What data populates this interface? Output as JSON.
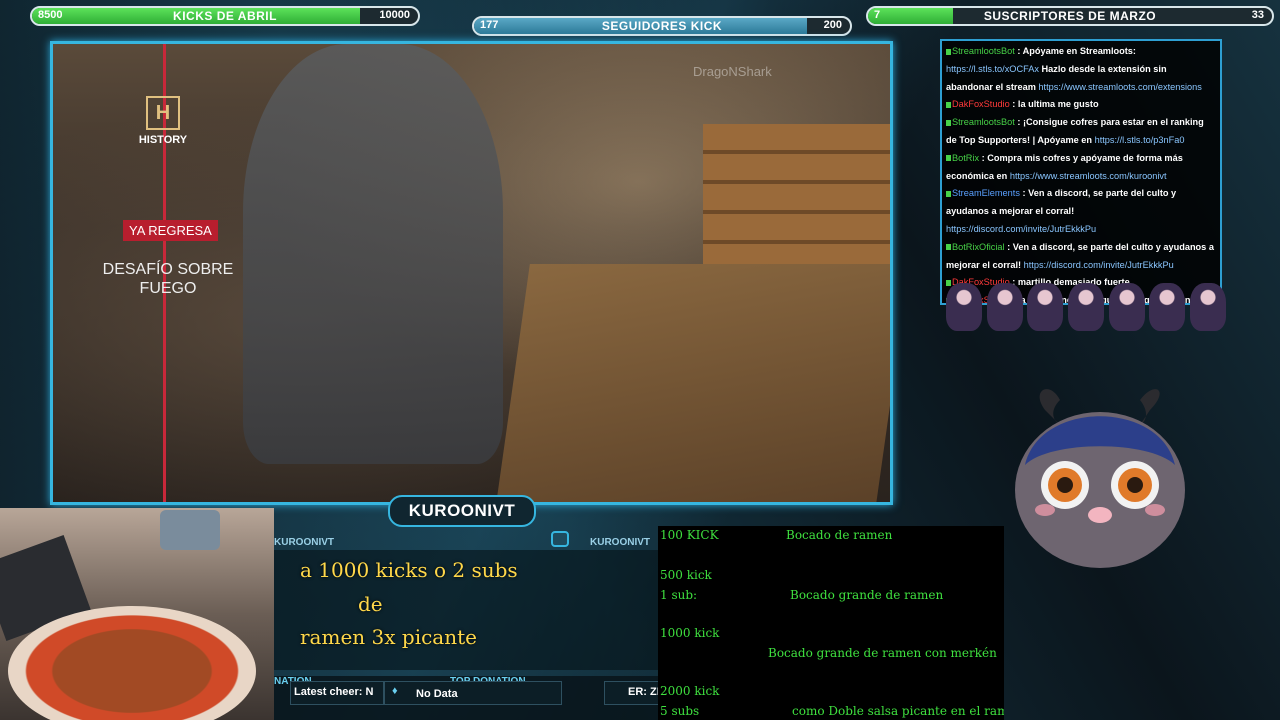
{
  "bars": {
    "left": {
      "title": "KICKS DE ABRIL",
      "current": "8500",
      "goal": "10000",
      "fill": 0.85
    },
    "center": {
      "title": "SEGUIDORES KICK",
      "current": "177",
      "goal": "200",
      "fill": 0.885
    },
    "right": {
      "title": "SUSCRIPTORES DE MARZO",
      "current": "7",
      "goal": "33",
      "fill": 0.21
    }
  },
  "video": {
    "logo_text": "HISTORY",
    "logo_glyph": "H",
    "tag": "YA REGRESA",
    "show_line1": "DESAFÍO SOBRE",
    "show_line2": "FUEGO",
    "watermark": "DragoNShark"
  },
  "chat": [
    {
      "user": "StreamlootsBot",
      "color": "#47d147",
      "text": "Apóyame en Streamloots: ",
      "link": "https://l.stls.to/xOCFAx",
      "text2": " Hazlo desde la extensión sin abandonar el stream ",
      "link2": "https://www.streamloots.com/extensions"
    },
    {
      "user": "DakFoxStudio",
      "color": "#ff3a3a",
      "text": "la ultima me gusto"
    },
    {
      "user": "StreamlootsBot",
      "color": "#47d147",
      "text": "¡Consigue cofres para estar en el ranking de Top Supporters! | Apóyame en ",
      "link": "https://l.stls.to/p3nFa0"
    },
    {
      "user": "BotRix",
      "color": "#47d147",
      "text": "Compra mis cofres y apóyame de forma más económica en ",
      "link": "https://www.streamloots.com/kuroonivt"
    },
    {
      "user": "StreamElements",
      "color": "#5aa0ff",
      "text": "Ven a discord, se parte del culto y ayudanos a mejorar el corral! ",
      "link": "https://discord.com/invite/JutrEkkkPu"
    },
    {
      "user": "BotRixOficial",
      "color": "#47d147",
      "text": "Ven a discord, se parte del culto y ayudanos a mejorar el corral! ",
      "link": "https://discord.com/invite/JutrEkkkPu"
    },
    {
      "user": "DakFoxStudio",
      "color": "#ff3a3a",
      "text": "martillo demasiado fuerte"
    },
    {
      "user": "DakFoxStudio",
      "color": "#ff3a3a",
      "text": "la prueba no decia que tenia que ser un cuchillo o si"
    }
  ],
  "channel": {
    "name": "KUROONIVT",
    "small_left": "KUROONIVT",
    "small_right": "KUROONIVT"
  },
  "goal": {
    "line1": "a 1000 kicks  o 2 subs",
    "line2": "de",
    "line3": "ramen 3x picante"
  },
  "menu": [
    {
      "k": "100 KICK",
      "d": "Bocado de ramen"
    },
    {
      "k": "500 kick",
      "d": ""
    },
    {
      "k": "1 sub:",
      "d": "Bocado grande de ramen"
    },
    {
      "k": "1000 kick",
      "d": ""
    },
    {
      "k": "",
      "d": "Bocado grande de ramen con merkén"
    },
    {
      "k": "2000 kick",
      "d": ""
    },
    {
      "k": "5 subs",
      "d": "como Doble salsa picante en el ramen"
    }
  ],
  "strip": {
    "latest_label": "NATION",
    "latest_cheer": "Latest cheer: N",
    "top_label": "TOP DONATION",
    "top_value": "No Data",
    "right_value": "ER: ZI"
  },
  "colors": {
    "accent": "#36b6e0",
    "bar_fill": "#45c945",
    "menu_text": "#3fe03f",
    "goal_text": "#ffd84a"
  }
}
